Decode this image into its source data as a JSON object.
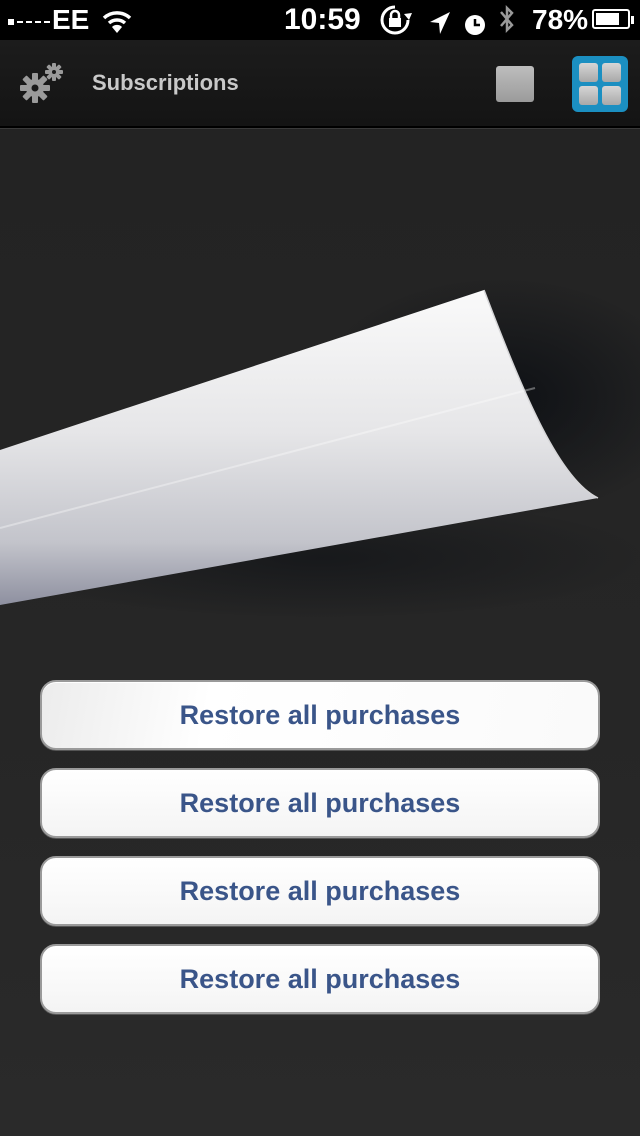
{
  "status_bar": {
    "carrier": "EE",
    "time": "10:59",
    "battery_percent": "78%",
    "battery_level": 0.78,
    "icons": [
      "signal-icon",
      "wifi-icon",
      "rotation-lock-icon",
      "location-icon",
      "alarm-icon",
      "bluetooth-icon",
      "battery-icon"
    ]
  },
  "nav_bar": {
    "title": "Subscriptions",
    "left_icon": "gears-icon",
    "right_icons": [
      "single-page-view-icon",
      "grid-view-icon"
    ],
    "accent_color": "#1b8fc1"
  },
  "restore": {
    "buttons": [
      {
        "label": "Restore all purchases"
      },
      {
        "label": "Restore all purchases"
      },
      {
        "label": "Restore all purchases"
      },
      {
        "label": "Restore all purchases"
      }
    ],
    "text_color": "#3a5589"
  }
}
